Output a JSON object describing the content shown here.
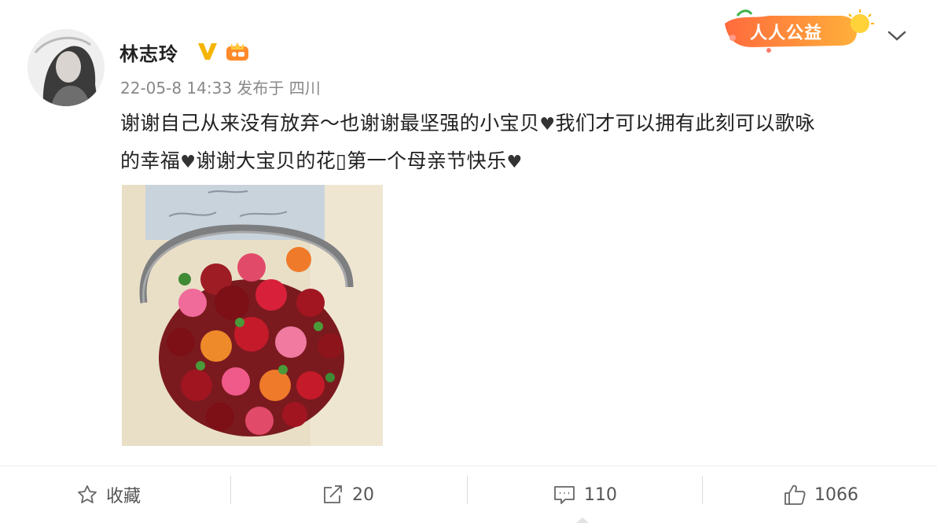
{
  "post": {
    "author": "林志玲",
    "time": "22-05-8 14:33",
    "location_prefix": "发布于",
    "location": "四川",
    "lines": [
      [
        {
          "t": "谢谢自己从来没有放弃～也谢谢最坚强的小宝贝"
        },
        {
          "t": "♥",
          "heart": true
        },
        {
          "t": "我们才可以拥有此刻可以歌咏"
        }
      ],
      [
        {
          "t": "的幸福"
        },
        {
          "t": "♥",
          "heart": true
        },
        {
          "t": "谢谢大宝贝的花▯第一个母亲节快乐"
        },
        {
          "t": "♥",
          "heart": true
        }
      ]
    ]
  },
  "badges": {
    "charity_label": "人人公益"
  },
  "icons": {
    "verified": "verified-v-icon",
    "level": "crown-level-icon",
    "collapse": "chevron-down-icon",
    "favorite": "star-outline-icon",
    "repost": "share-icon",
    "comment": "comment-icon",
    "like": "thumbs-up-icon"
  },
  "toolbar": {
    "favorite_label": "收藏",
    "repost_count": "20",
    "comment_count": "110",
    "like_count": "1066"
  },
  "colors": {
    "verified": "#f5b400",
    "charity_gradient_start": "#ff6a3d",
    "charity_gradient_end": "#ffb03a",
    "text_primary": "#222222",
    "text_meta": "#888888"
  }
}
